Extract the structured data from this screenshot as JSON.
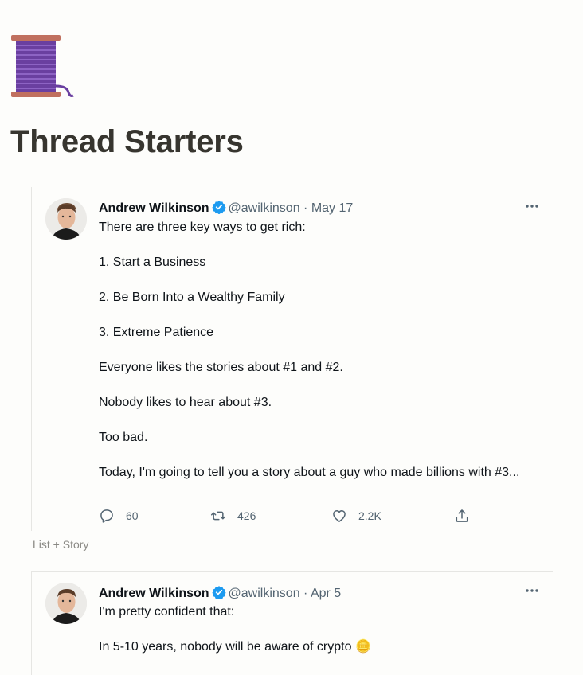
{
  "page": {
    "title": "Thread Starters",
    "icon": "spool-of-thread-icon"
  },
  "tweets": [
    {
      "author": "Andrew Wilkinson",
      "handle": "@awilkinson",
      "separator": "·",
      "date": "May 17",
      "paragraphs": [
        "There are three key ways to get rich:",
        "1. Start a Business",
        "2. Be Born Into a Wealthy Family",
        "3. Extreme Patience",
        "Everyone likes the stories about #1 and #2.",
        "Nobody likes to hear about #3.",
        "Too bad.",
        "Today, I'm going to tell you a story about a guy who made billions with #3..."
      ],
      "actions": {
        "replies": "60",
        "retweets": "426",
        "likes": "2.2K"
      },
      "caption": "List + Story"
    },
    {
      "author": "Andrew Wilkinson",
      "handle": "@awilkinson",
      "separator": "·",
      "date": "Apr 5",
      "paragraphs": [
        "I'm pretty confident that:",
        "In 5-10 years, nobody will be aware of crypto 🪙"
      ]
    }
  ],
  "colors": {
    "background": "#fdfdfb",
    "title": "#37352f",
    "text": "#0f1419",
    "muted": "#536471",
    "verified": "#1d9bf0",
    "caption": "#8a8984"
  }
}
